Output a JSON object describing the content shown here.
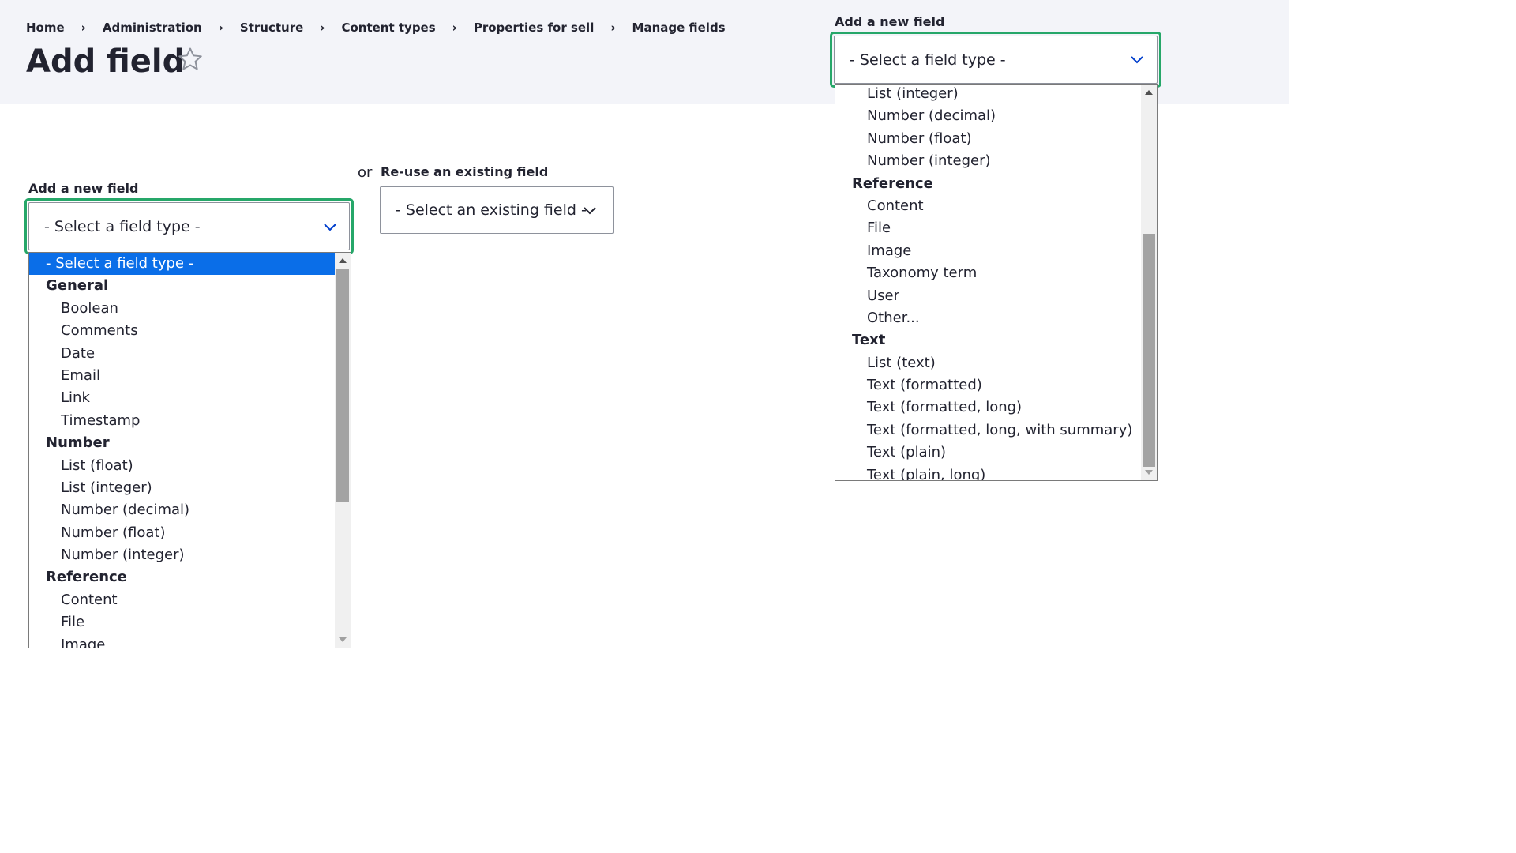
{
  "breadcrumb": [
    "Home",
    "Administration",
    "Structure",
    "Content types",
    "Properties for sell",
    "Manage fields"
  ],
  "breadcrumb_separator": "›",
  "page_title": "Add field",
  "left_form": {
    "add_label": "Add a new field",
    "select_value": "- Select a field type -",
    "or_text": "or",
    "reuse_label": "Re-use an existing field",
    "reuse_value": "- Select an existing field -"
  },
  "left_dropdown": {
    "items": [
      {
        "t": "opt",
        "label": "- Select a field type -",
        "selected": true
      },
      {
        "t": "grp",
        "label": "General"
      },
      {
        "t": "opt",
        "label": "Boolean"
      },
      {
        "t": "opt",
        "label": "Comments"
      },
      {
        "t": "opt",
        "label": "Date"
      },
      {
        "t": "opt",
        "label": "Email"
      },
      {
        "t": "opt",
        "label": "Link"
      },
      {
        "t": "opt",
        "label": "Timestamp"
      },
      {
        "t": "grp",
        "label": "Number"
      },
      {
        "t": "opt",
        "label": "List (float)"
      },
      {
        "t": "opt",
        "label": "List (integer)"
      },
      {
        "t": "opt",
        "label": "Number (decimal)"
      },
      {
        "t": "opt",
        "label": "Number (float)"
      },
      {
        "t": "opt",
        "label": "Number (integer)"
      },
      {
        "t": "grp",
        "label": "Reference"
      },
      {
        "t": "opt",
        "label": "Content"
      },
      {
        "t": "opt",
        "label": "File"
      },
      {
        "t": "opt",
        "label": "Image"
      }
    ]
  },
  "right_form": {
    "add_label": "Add a new field",
    "select_value": "- Select a field type -"
  },
  "right_dropdown": {
    "items": [
      {
        "t": "opt",
        "label": "List (integer)"
      },
      {
        "t": "opt",
        "label": "Number (decimal)"
      },
      {
        "t": "opt",
        "label": "Number (float)"
      },
      {
        "t": "opt",
        "label": "Number (integer)"
      },
      {
        "t": "grp",
        "label": "Reference"
      },
      {
        "t": "opt",
        "label": "Content"
      },
      {
        "t": "opt",
        "label": "File"
      },
      {
        "t": "opt",
        "label": "Image"
      },
      {
        "t": "opt",
        "label": "Taxonomy term"
      },
      {
        "t": "opt",
        "label": "User"
      },
      {
        "t": "opt",
        "label": "Other..."
      },
      {
        "t": "grp",
        "label": "Text"
      },
      {
        "t": "opt",
        "label": "List (text)"
      },
      {
        "t": "opt",
        "label": "Text (formatted)"
      },
      {
        "t": "opt",
        "label": "Text (formatted, long)"
      },
      {
        "t": "opt",
        "label": "Text (formatted, long, with summary)"
      },
      {
        "t": "opt",
        "label": "Text (plain)"
      },
      {
        "t": "opt",
        "label": "Text (plain, long)"
      }
    ]
  },
  "colors": {
    "focus": "#26a769",
    "selection": "#0a6ee8",
    "header_bg": "#f3f4f9",
    "chevron": "#003ecc"
  },
  "icons": [
    "star-icon",
    "chevron-down-icon"
  ]
}
